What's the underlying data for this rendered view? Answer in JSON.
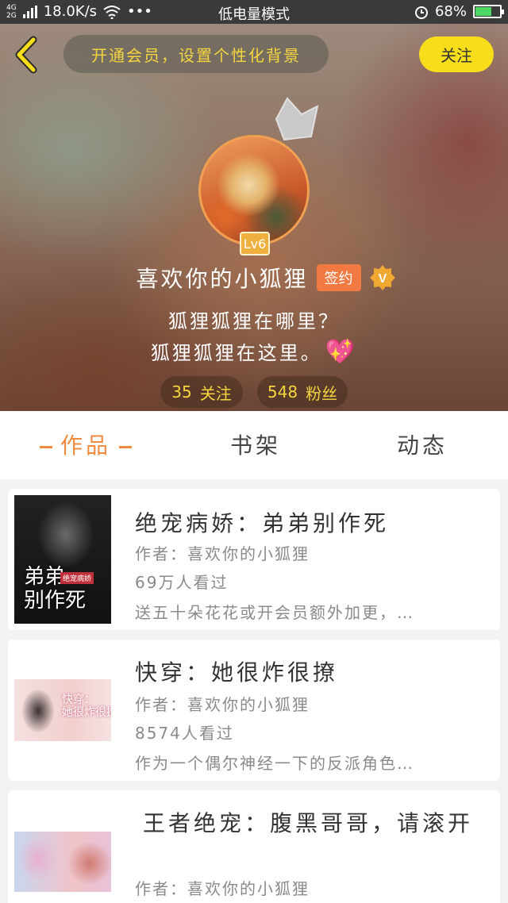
{
  "status_bar": {
    "network": "4G\n2G",
    "speed": "18.0K/s",
    "dots": "•••",
    "mode": "低电量模式",
    "battery": "68%",
    "battery_level": 0.68
  },
  "header": {
    "vip_banner": "开通会员，设置个性化背景",
    "follow_label": "关注",
    "level": "Lv6",
    "username": "喜欢你的小狐狸",
    "signed_label": "签约",
    "bio_line1": "狐狸狐狸在哪里？",
    "bio_line2": "狐狸狐狸在这里。",
    "bio_emoji": "💖",
    "following_count": "35",
    "following_label": "关注",
    "fans_count": "548",
    "fans_label": "粉丝"
  },
  "tabs": {
    "works": "作品",
    "shelf": "书架",
    "feed": "动态"
  },
  "books": [
    {
      "title": "绝宠病娇：弟弟别作死",
      "author": "作者：喜欢你的小狐狸",
      "views": "69万人看过",
      "desc": "送五十朵花花或开会员额外加更，…",
      "cover_text": "弟弟\n别作死",
      "cover_tag": "绝宠病娇"
    },
    {
      "title": "快穿：她很炸很撩",
      "author": "作者：喜欢你的小狐狸",
      "views": "8574人看过",
      "desc": "作为一个偶尔神经一下的反派角色…",
      "cover_text": "快穿：\n她很炸很撩"
    },
    {
      "title": "王者绝宠：腹黑哥哥，请滚开",
      "author": "作者：喜欢你的小狐狸"
    }
  ],
  "colors": {
    "accent": "#f08a40",
    "follow_button": "#f7dd1a",
    "banner_text": "#f6d53f"
  }
}
